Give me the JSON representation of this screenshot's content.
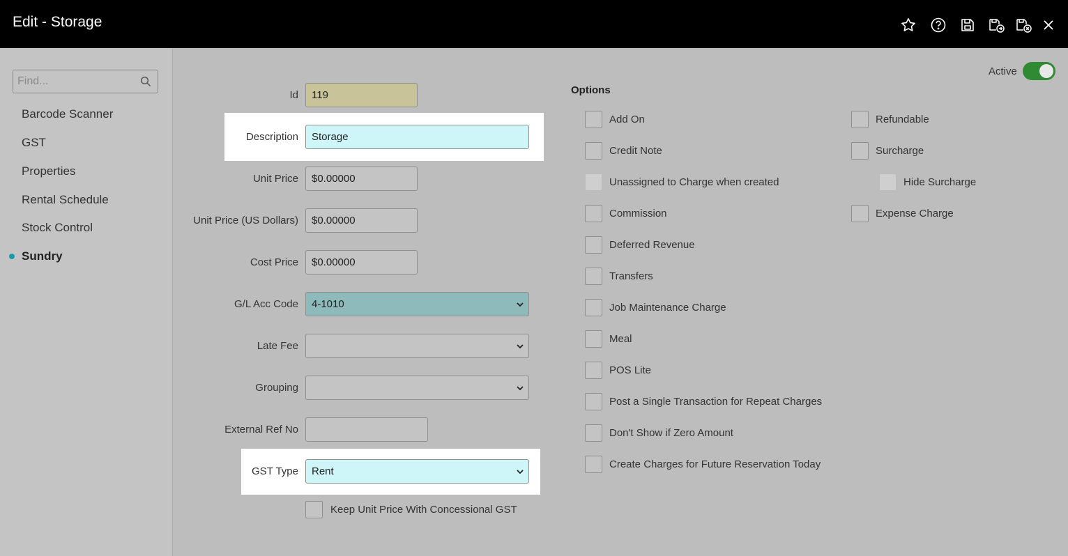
{
  "header": {
    "title": "Edit - Storage",
    "icons": [
      "star-icon",
      "help-icon",
      "save-icon",
      "save-and-new-icon",
      "save-and-close-icon",
      "close-icon"
    ]
  },
  "sidebar": {
    "search": {
      "placeholder": "Find...",
      "value": ""
    },
    "items": [
      {
        "label": "Barcode Scanner",
        "active": false
      },
      {
        "label": "GST",
        "active": false
      },
      {
        "label": "Properties",
        "active": false
      },
      {
        "label": "Rental Schedule",
        "active": false
      },
      {
        "label": "Stock Control",
        "active": false
      },
      {
        "label": "Sundry",
        "active": true
      }
    ]
  },
  "form": {
    "id": {
      "label": "Id",
      "value": "119"
    },
    "description": {
      "label": "Description",
      "value": "Storage"
    },
    "unit_price": {
      "label": "Unit Price",
      "value": "$0.00000"
    },
    "unit_price_usd": {
      "label": "Unit Price (US Dollars)",
      "value": "$0.00000"
    },
    "cost_price": {
      "label": "Cost Price",
      "value": "$0.00000"
    },
    "gl_acc_code": {
      "label": "G/L Acc Code",
      "value": "4-1010"
    },
    "late_fee": {
      "label": "Late Fee",
      "value": ""
    },
    "grouping": {
      "label": "Grouping",
      "value": ""
    },
    "external_ref_no": {
      "label": "External Ref No",
      "value": ""
    },
    "gst_type": {
      "label": "GST Type",
      "value": "Rent"
    },
    "keep_unit_price": {
      "label": "Keep Unit Price With Concessional GST",
      "checked": false
    }
  },
  "active": {
    "label": "Active",
    "on": true
  },
  "options": {
    "title": "Options",
    "left": [
      {
        "label": "Add On",
        "checked": false,
        "disabled": false
      },
      {
        "label": "Credit Note",
        "checked": false,
        "disabled": false
      },
      {
        "label": "Unassigned to Charge when created",
        "checked": false,
        "disabled": true
      },
      {
        "label": "Commission",
        "checked": false,
        "disabled": false
      },
      {
        "label": "Deferred Revenue",
        "checked": false,
        "disabled": false
      },
      {
        "label": "Transfers",
        "checked": false,
        "disabled": false
      },
      {
        "label": "Job Maintenance Charge",
        "checked": false,
        "disabled": false
      },
      {
        "label": "Meal",
        "checked": false,
        "disabled": false
      },
      {
        "label": "POS Lite",
        "checked": false,
        "disabled": false
      },
      {
        "label": "Post a Single Transaction for Repeat Charges",
        "checked": false,
        "disabled": false
      },
      {
        "label": "Don't Show if Zero Amount",
        "checked": false,
        "disabled": false
      },
      {
        "label": "Create Charges for Future Reservation Today",
        "checked": false,
        "disabled": false
      }
    ],
    "right": [
      {
        "label": "Refundable",
        "checked": false,
        "disabled": false
      },
      {
        "label": "Surcharge",
        "checked": false,
        "disabled": false
      },
      {
        "label": "Hide Surcharge",
        "checked": false,
        "disabled": true
      },
      {
        "label": "Expense Charge",
        "checked": false,
        "disabled": false
      }
    ]
  },
  "colors": {
    "header_bg": "#000000",
    "page_bg": "#bdbdbd",
    "highlight_field": "#cef6f8",
    "gl_select": "#8fbabc",
    "id_field": "#c9c39a",
    "toggle_on": "#2f8a33",
    "active_dot": "#1a9aa8"
  }
}
